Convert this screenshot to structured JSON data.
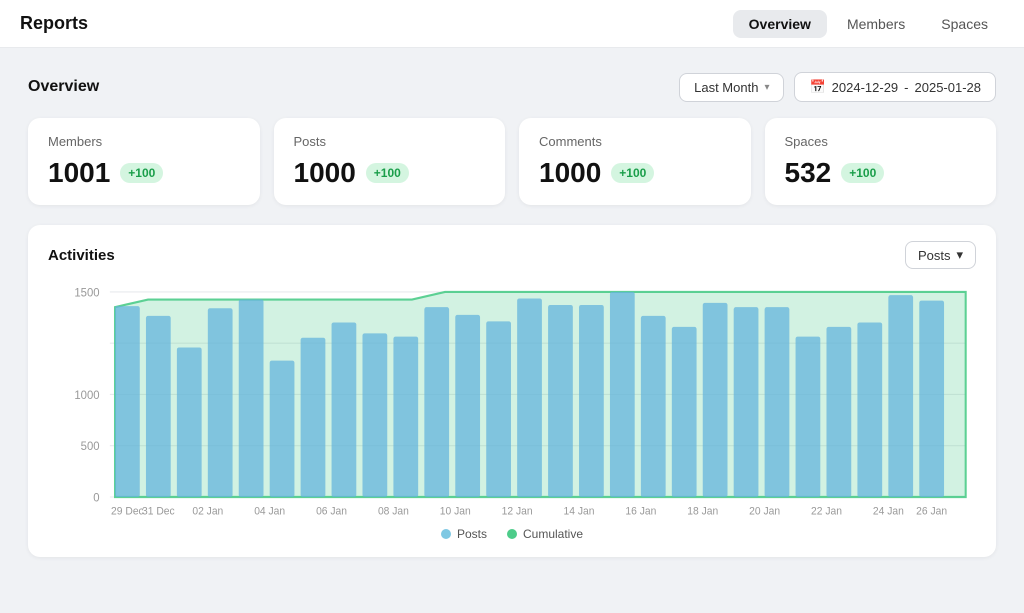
{
  "app": {
    "title": "Reports"
  },
  "topNav": {
    "items": [
      {
        "label": "Overview",
        "active": true
      },
      {
        "label": "Members",
        "active": false
      },
      {
        "label": "Spaces",
        "active": false
      }
    ]
  },
  "overview": {
    "title": "Overview",
    "filter": {
      "period_label": "Last Month",
      "date_from": "2024-12-29",
      "date_separator": "-",
      "date_to": "2025-01-28"
    },
    "stats": [
      {
        "label": "Members",
        "value": "1001",
        "badge": "+100"
      },
      {
        "label": "Posts",
        "value": "1000",
        "badge": "+100"
      },
      {
        "label": "Comments",
        "value": "1000",
        "badge": "+100"
      },
      {
        "label": "Spaces",
        "value": "532",
        "badge": "+100"
      }
    ]
  },
  "activities": {
    "title": "Activities",
    "filter_label": "Posts",
    "x_labels": [
      "29 Dec",
      "31 Dec",
      "02 Jan",
      "04 Jan",
      "06 Jan",
      "08 Jan",
      "10 Jan",
      "12 Jan",
      "14 Jan",
      "16 Jan",
      "18 Jan",
      "20 Jan",
      "22 Jan",
      "24 Jan",
      "26 Jan"
    ],
    "y_labels": [
      "0",
      "500",
      "1000",
      "1500"
    ],
    "legend": [
      {
        "label": "Posts",
        "color": "#7ec8e3"
      },
      {
        "label": "Cumulative",
        "color": "#4dcc8a"
      }
    ],
    "bar_values": [
      1320,
      1250,
      1100,
      1310,
      1360,
      1000,
      1120,
      1200,
      1180,
      1170,
      1330,
      1290,
      1260,
      1370,
      1340,
      1310,
      1430,
      1250,
      1210,
      1350,
      1320,
      1310,
      1180,
      1200,
      1220,
      1410,
      1380
    ],
    "cumulative_points": [
      1340,
      1430,
      1430,
      1430,
      1430,
      1430,
      1430,
      1430,
      1430,
      1430,
      1490,
      1490,
      1490,
      1490,
      1490,
      1490,
      1490,
      1490,
      1490,
      1490,
      1490,
      1490,
      1490,
      1490,
      1490,
      1490,
      1490
    ]
  }
}
